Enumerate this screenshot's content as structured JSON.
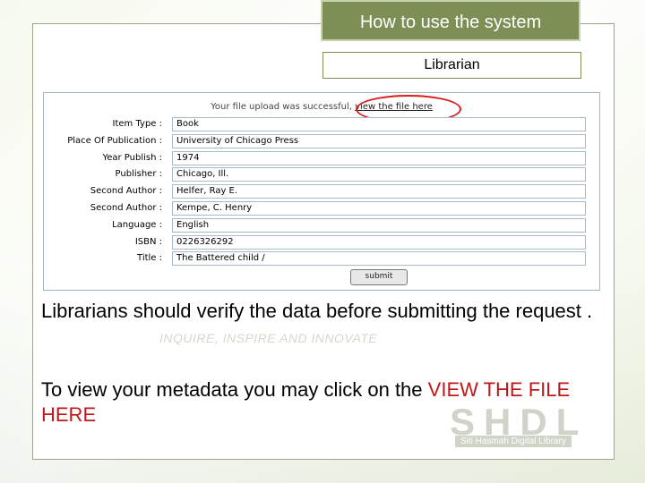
{
  "slide": {
    "title": "How to use the system",
    "subtitle": "Librarian"
  },
  "form": {
    "message_prefix": "Your file upload was successful,",
    "message_link": "view the file here",
    "fields": [
      {
        "label": "Item Type :",
        "value": "Book"
      },
      {
        "label": "Place Of Publication :",
        "value": "University of Chicago Press"
      },
      {
        "label": "Year Publish :",
        "value": "1974"
      },
      {
        "label": "Publisher :",
        "value": "Chicago, Ill."
      },
      {
        "label": "Second Author :",
        "value": "Helfer, Ray E."
      },
      {
        "label": "Second Author :",
        "value": "Kempe, C. Henry"
      },
      {
        "label": "Language :",
        "value": "English"
      },
      {
        "label": "ISBN :",
        "value": "0226326292"
      },
      {
        "label": "Title :",
        "value": "The Battered child /"
      }
    ],
    "submit_label": "submit"
  },
  "body": {
    "line1": "Librarians should verify the data before submitting the request .",
    "line2_prefix": "To view your metadata you may click on the ",
    "line2_highlight": "VIEW THE FILE HERE"
  },
  "background": {
    "tagline": "INQUIRE, INSPIRE AND INNOVATE",
    "logo": "SHDL",
    "logo_caption": "Siti Hasmah Digital Library"
  },
  "colors": {
    "title_bg": "#7d8f55",
    "highlight": "#c0171b",
    "ring": "#d51e1e"
  }
}
